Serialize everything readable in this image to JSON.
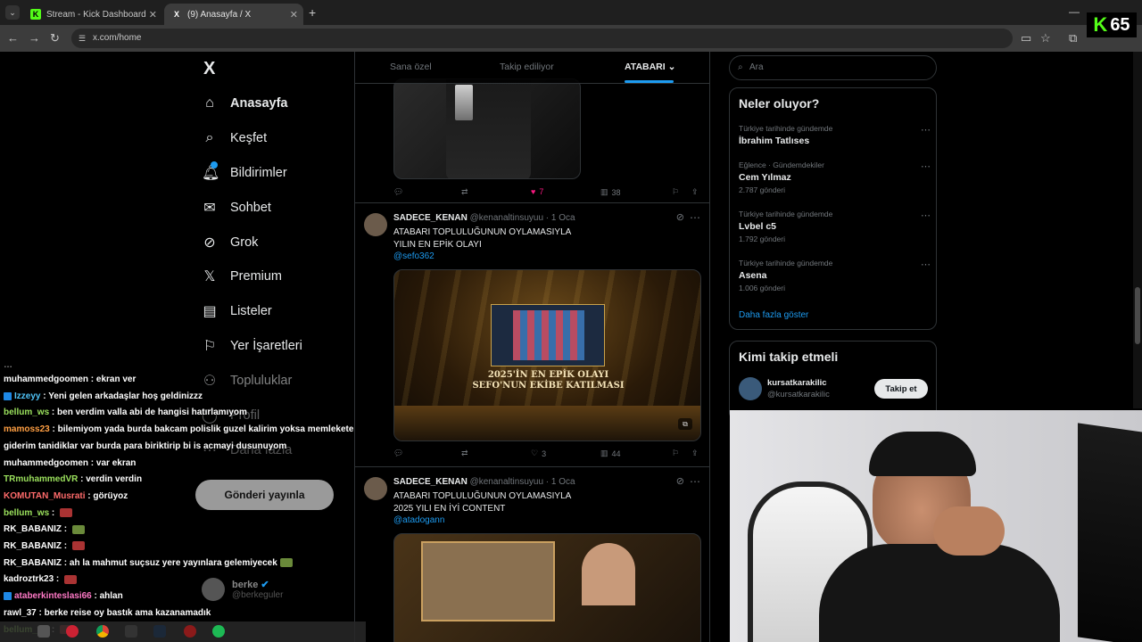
{
  "browser": {
    "tabs": [
      {
        "label": "Stream - Kick Dashboard",
        "favicon": "K",
        "active": false
      },
      {
        "label": "(9) Anasayfa / X",
        "favicon": "X",
        "active": true
      }
    ],
    "new_tab": "+",
    "url": "x.com/home"
  },
  "kick_overlay": {
    "count": "65",
    "logo": "K"
  },
  "sidebar": {
    "logo": "X",
    "items": [
      {
        "label": "Anasayfa",
        "icon": "home-icon"
      },
      {
        "label": "Keşfet",
        "icon": "search-icon"
      },
      {
        "label": "Bildirimler",
        "icon": "bell-icon"
      },
      {
        "label": "Sohbet",
        "icon": "mail-icon"
      },
      {
        "label": "Grok",
        "icon": "grok-icon"
      },
      {
        "label": "Premium",
        "icon": "x-icon"
      },
      {
        "label": "Listeler",
        "icon": "list-icon"
      },
      {
        "label": "Yer İşaretleri",
        "icon": "bookmark-icon"
      },
      {
        "label": "Topluluklar",
        "icon": "people-icon"
      },
      {
        "label": "Profil",
        "icon": "user-icon"
      },
      {
        "label": "Daha fazla",
        "icon": "more-icon"
      }
    ],
    "post_button": "Gönderi yayınla",
    "account": {
      "name": "berke",
      "handle": "@berkeguler"
    }
  },
  "feed": {
    "tabs": [
      "Sana özel",
      "Takip ediliyor",
      "ATABARI"
    ],
    "tweets": [
      {
        "replies": "",
        "retweets": "",
        "likes": "7",
        "views": "38"
      },
      {
        "name": "SADECE_KENAN",
        "handle": "@kenanaltinsuyuu",
        "time": "· 1 Oca",
        "text_line1": "ATABARI TOPLULUĞUNUN  OYLAMASIYLA",
        "text_line2": "YILIN EN EPİK OLAYI",
        "mention": "@sefo362",
        "media_caption_1": "2025'İN EN EPİK OLAYI",
        "media_caption_2": "SEFO'NUN EKİBE KATILMASI",
        "replies": "",
        "retweets": "",
        "likes": "3",
        "views": "44"
      },
      {
        "name": "SADECE_KENAN",
        "handle": "@kenanaltinsuyuu",
        "time": "· 1 Oca",
        "text_line1": "ATABARI TOPLULUĞUNUN  OYLAMASIYLA",
        "text_line2": "2025 YILI EN İYİ CONTENT",
        "mention": "@atadogann"
      }
    ]
  },
  "right": {
    "search_placeholder": "Ara",
    "trends_title": "Neler oluyor?",
    "trends": [
      {
        "context": "Türkiye tarihinde gündemde",
        "name": "İbrahim Tatlıses",
        "count": ""
      },
      {
        "context": "Eğlence · Gündemdekiler",
        "name": "Cem Yılmaz",
        "count": "2.787 gönderi"
      },
      {
        "context": "Türkiye tarihinde gündemde",
        "name": "Lvbel c5",
        "count": "1.792 gönderi"
      },
      {
        "context": "Türkiye tarihinde gündemde",
        "name": "Asena",
        "count": "1.006 gönderi"
      }
    ],
    "show_more": "Daha fazla göster",
    "who_to_follow_title": "Kimi takip etmeli",
    "suggestion": {
      "name": "kursatkarakilic",
      "handle": "@kursatkarakilic",
      "button": "Takip et"
    }
  },
  "chat": [
    {
      "user": "muhammedgoomen",
      "color": "#ffffff",
      "msg": "ekran ver"
    },
    {
      "user": "Izzeyy",
      "color": "#4fc3f7",
      "msg": "Yeni gelen arkadaşlar hoş geldinizzz",
      "badge": true
    },
    {
      "user": "bellum_ws",
      "color": "#9be15d",
      "msg": "ben verdim valla abi de hangisi hatırlamıyom"
    },
    {
      "user": "mamoss23",
      "color": "#ff9f43",
      "msg": "bilemiyom yada burda bakcam polislik guzel kalirim yoksa memlekete"
    },
    {
      "user": "",
      "color": "#ffffff",
      "msg": "giderim tanidiklar var burda para biriktirip bi is acmayi dusunuyom"
    },
    {
      "user": "muhammedgoomen",
      "color": "#ffffff",
      "msg": "var ekran"
    },
    {
      "user": "TRmuhammedVR",
      "color": "#9be15d",
      "msg": "verdin verdin"
    },
    {
      "user": "KOMUTAN_Musrati",
      "color": "#ff6b6b",
      "msg": "görüyoz"
    },
    {
      "user": "bellum_ws",
      "color": "#9be15d",
      "msg": "",
      "emote": "red"
    },
    {
      "user": "RK_BABANIZ",
      "color": "#ffffff",
      "msg": "",
      "emote": "green"
    },
    {
      "user": "RK_BABANIZ",
      "color": "#ffffff",
      "msg": "",
      "emote": "red"
    },
    {
      "user": "RK_BABANIZ",
      "color": "#ffffff",
      "msg": "ah la mahmut suçsuz yere yayınlara gelemiyecek",
      "emote": "green"
    },
    {
      "user": "kadroztrk23",
      "color": "#ffffff",
      "msg": "",
      "emote": "red"
    },
    {
      "user": "ataberkinteslasi66",
      "color": "#ff79c6",
      "msg": "ahlan",
      "badge": true
    },
    {
      "user": "rawl_37",
      "color": "#ffffff",
      "msg": "berke reise oy bastık ama kazanamadık"
    },
    {
      "user": "bellum_ws",
      "color": "#9be15d",
      "msg": "",
      "emote": "red"
    }
  ],
  "colors": {
    "accent": "#1d9bf0",
    "like": "#f91880",
    "kick": "#53fc18"
  }
}
